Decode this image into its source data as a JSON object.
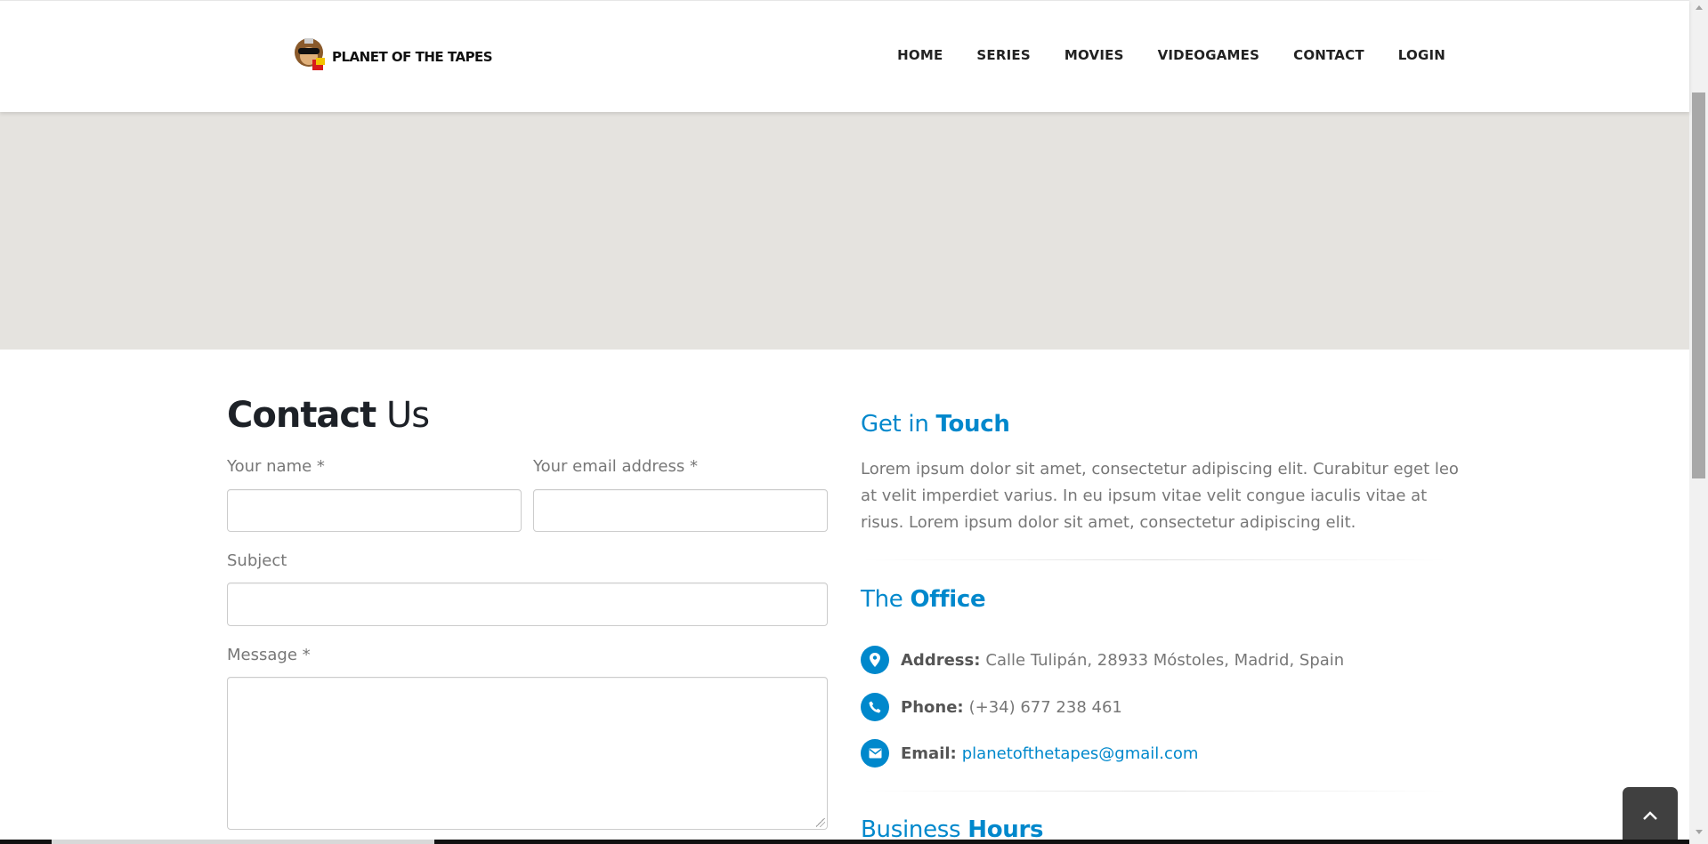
{
  "header": {
    "logo_text": "PLANET OF THE TAPES",
    "nav": [
      "HOME",
      "SERIES",
      "MOVIES",
      "VIDEOGAMES",
      "CONTACT",
      "LOGIN"
    ]
  },
  "contact_form": {
    "title_bold": "Contact",
    "title_light": "Us",
    "name_label": "Your name *",
    "email_label": "Your email address *",
    "subject_label": "Subject",
    "message_label": "Message *",
    "name_value": "",
    "email_value": "",
    "subject_value": "",
    "message_value": ""
  },
  "get_in_touch": {
    "heading_light": "Get in",
    "heading_bold": "Touch",
    "text": "Lorem ipsum dolor sit amet, consectetur adipiscing elit. Curabitur eget leo at velit imperdiet varius. In eu ipsum vitae velit congue iaculis vitae at risus. Lorem ipsum dolor sit amet, consectetur adipiscing elit."
  },
  "office": {
    "heading_light": "The",
    "heading_bold": "Office",
    "address_label": "Address:",
    "address": "Calle Tulipán, 28933 Móstoles, Madrid, Spain",
    "phone_label": "Phone:",
    "phone": "(+34) 677 238 461",
    "email_label": "Email:",
    "email": "planetofthetapes@gmail.com"
  },
  "hours": {
    "heading_light": "Business",
    "heading_bold": "Hours"
  },
  "colors": {
    "accent": "#0088cc",
    "map_bg": "#e5e3df",
    "heading_dark": "#1d2127"
  },
  "icons": [
    "map-marker-icon",
    "phone-icon",
    "envelope-icon",
    "chevron-up-icon"
  ]
}
